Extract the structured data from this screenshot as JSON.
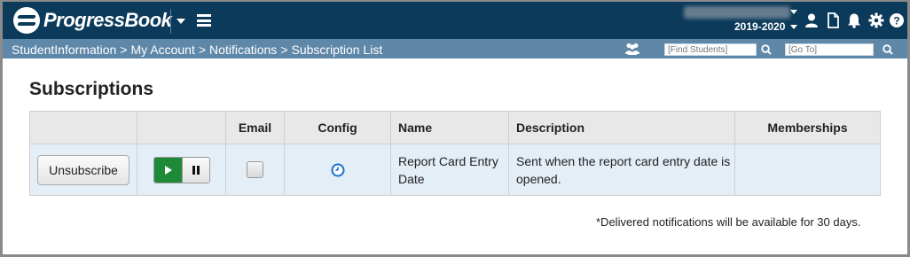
{
  "app": {
    "brand": "ProgressBook",
    "school_year": "2019-2020"
  },
  "breadcrumb": {
    "items": [
      "StudentInformation",
      "My Account",
      "Notifications",
      "Subscription List"
    ],
    "separator": ">"
  },
  "search": {
    "find_students_placeholder": "[Find Students]",
    "goto_placeholder": "[Go To]"
  },
  "page": {
    "title": "Subscriptions"
  },
  "table": {
    "headers": [
      "",
      "",
      "Email",
      "Config",
      "Name",
      "Description",
      "Memberships"
    ],
    "rows": [
      {
        "action_label": "Unsubscribe",
        "email_checked": false,
        "name": "Report Card Entry Date",
        "description": "Sent when the report card entry date is opened.",
        "memberships": ""
      }
    ]
  },
  "footnote": "*Delivered notifications will be available for 30 days.",
  "icons": {
    "user": "user-icon",
    "document": "document-icon",
    "bell": "bell-icon",
    "settings": "gear-icon",
    "help": "help-icon",
    "group": "group-icon",
    "search": "search-icon",
    "play": "play-icon",
    "pause": "pause-icon",
    "clock": "clock-icon"
  },
  "colors": {
    "topbar": "#0b3a5a",
    "breadcrumb_bar": "#5f87a8",
    "play_green": "#1e8a38",
    "row_bg": "#e4eef7",
    "clock_blue": "#1a6fd1"
  }
}
